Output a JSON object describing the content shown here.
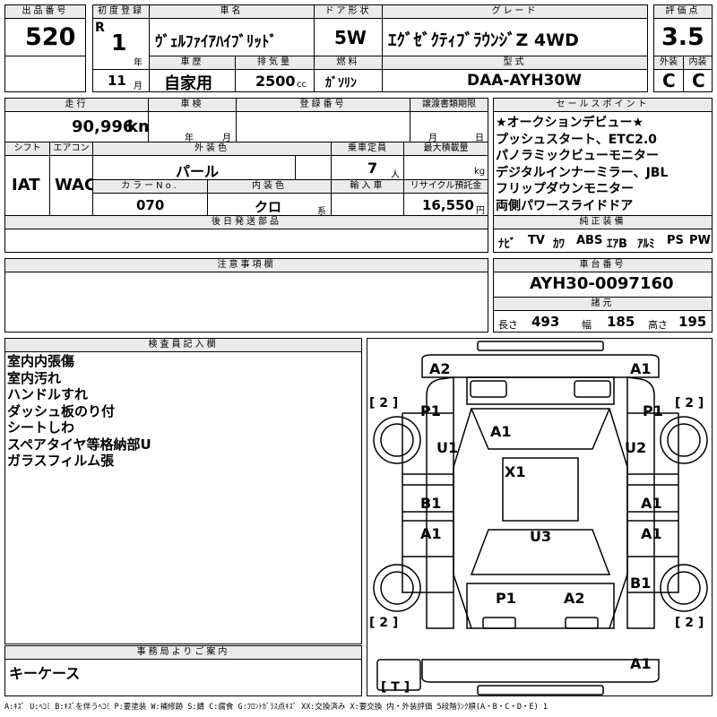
{
  "header": {
    "lot_label": "出品番号",
    "lot": "520",
    "first_reg_label": "初度登録",
    "era": "R",
    "reg_year": "1",
    "year_unit": "年",
    "reg_month": "11",
    "month_unit": "月",
    "car_name_label": "車名",
    "car_name": "ｳﾞｪﾙﾌｧｲｱﾊｲﾌﾞﾘｯﾄﾞ",
    "door_label": "ドア形状",
    "door": "5W",
    "grade_label": "グレード",
    "grade": "ｴｸﾞｾﾞｸﾃｨﾌﾞﾗｳﾝｼﾞZ 4WD",
    "score_label": "評価点",
    "score": "3.5",
    "history_label": "車歴",
    "history": "自家用",
    "disp_label": "排気量",
    "disp": "2500",
    "disp_unit": "cc",
    "fuel_label": "燃料",
    "fuel": "ｶﾞｿﾘﾝ",
    "model_label": "型式",
    "model": "DAA-AYH30W",
    "ext_label": "外装",
    "ext": "C",
    "int_label": "内装",
    "int": "C"
  },
  "specs": {
    "mileage_label": "走行",
    "mileage": "90,996",
    "mileage_unit": "km",
    "inspection_label": "車検",
    "year_unit": "年",
    "month_unit": "月",
    "regno_label": "登録番号",
    "transfer_label": "譲渡書類期限",
    "day_unit": "日",
    "shift_label": "シフト",
    "shift": "IAT",
    "ac_label": "エアコン",
    "ac": "WAC",
    "color_label": "外装色",
    "color": "パール",
    "capacity_label": "乗車定員",
    "capacity": "7",
    "capacity_unit": "人",
    "load_label": "最大積載量",
    "load_unit": "kg",
    "colorno_label": "カラーNo.",
    "colorno": "070",
    "intcolor_label": "内装色",
    "intcolor": "クロ",
    "intcolor_unit": "系",
    "import_label": "輸入車",
    "recycle_label": "リサイクル預託金",
    "recycle": "16,550",
    "recycle_unit": "円",
    "later_label": "後日発送部品"
  },
  "sales_points": {
    "label": "セールスポイント",
    "lines": "★オークションデビュー★\nプッシュスタート、ETC2.0\nパノラミックビューモニター\nデジタルインナーミラー、JBL\nフリップダウンモニター\n両側パワースライドドア"
  },
  "equipment": {
    "label": "純正装備",
    "items": [
      "ﾅﾋﾞ",
      "TV",
      "ｶﾜ",
      "ABS",
      "ｴｱB",
      "ｱﾙﾐ",
      "PS",
      "PW"
    ]
  },
  "notes": {
    "label": "注意事項欄"
  },
  "chassis": {
    "label": "車台番号",
    "number": "AYH30-0097160",
    "dims_label": "諸元",
    "length_label": "長さ",
    "length": "493",
    "width_label": "幅",
    "width": "185",
    "height_label": "高さ",
    "height": "195"
  },
  "inspector": {
    "label": "検査員記入欄",
    "lines": "室内内張傷\n室内汚れ\nハンドルすれ\nダッシュ板のり付\nシートしわ\nスペアタイヤ等格納部U\nガラスフィルム張"
  },
  "office": {
    "label": "事務局よりご案内",
    "text": "キーケース"
  },
  "diagram": {
    "marks": {
      "a2_front_left": "A2",
      "a1_front_right": "A1",
      "tire_fl": "[ 2 ]",
      "tire_fr": "[ 2 ]",
      "tire_rl": "[ 2 ]",
      "tire_rr": "[ 2 ]",
      "p1_left": "P1",
      "p1_right": "P1",
      "a1_hood": "A1",
      "u1": "U1",
      "u2": "U2",
      "x1_roof": "X1",
      "b1_left": "B1",
      "a1_right_door": "A1",
      "a1_left_rear": "A1",
      "a1_right_rear": "A1",
      "u3": "U3",
      "b1_right": "B1",
      "p1_trunk": "P1",
      "a2_trunk": "A2",
      "a1_bottom": "A1",
      "tire_spare": "[ T ]"
    }
  },
  "legend": {
    "text": "A:ｷｽﾞ U:ﾍｺﾐ B:ｷｽﾞを伴うﾍｺﾐ P:要塗装 W:補修跡 S:錆 C:腐食 G:ﾌﾛﾝﾄｶﾞﾗｽ点ｷｽﾞ XX:交換済み X:要交換 内・外装評価 5段階ﾗﾝｸ順(A・B・C・D・E) 1"
  }
}
